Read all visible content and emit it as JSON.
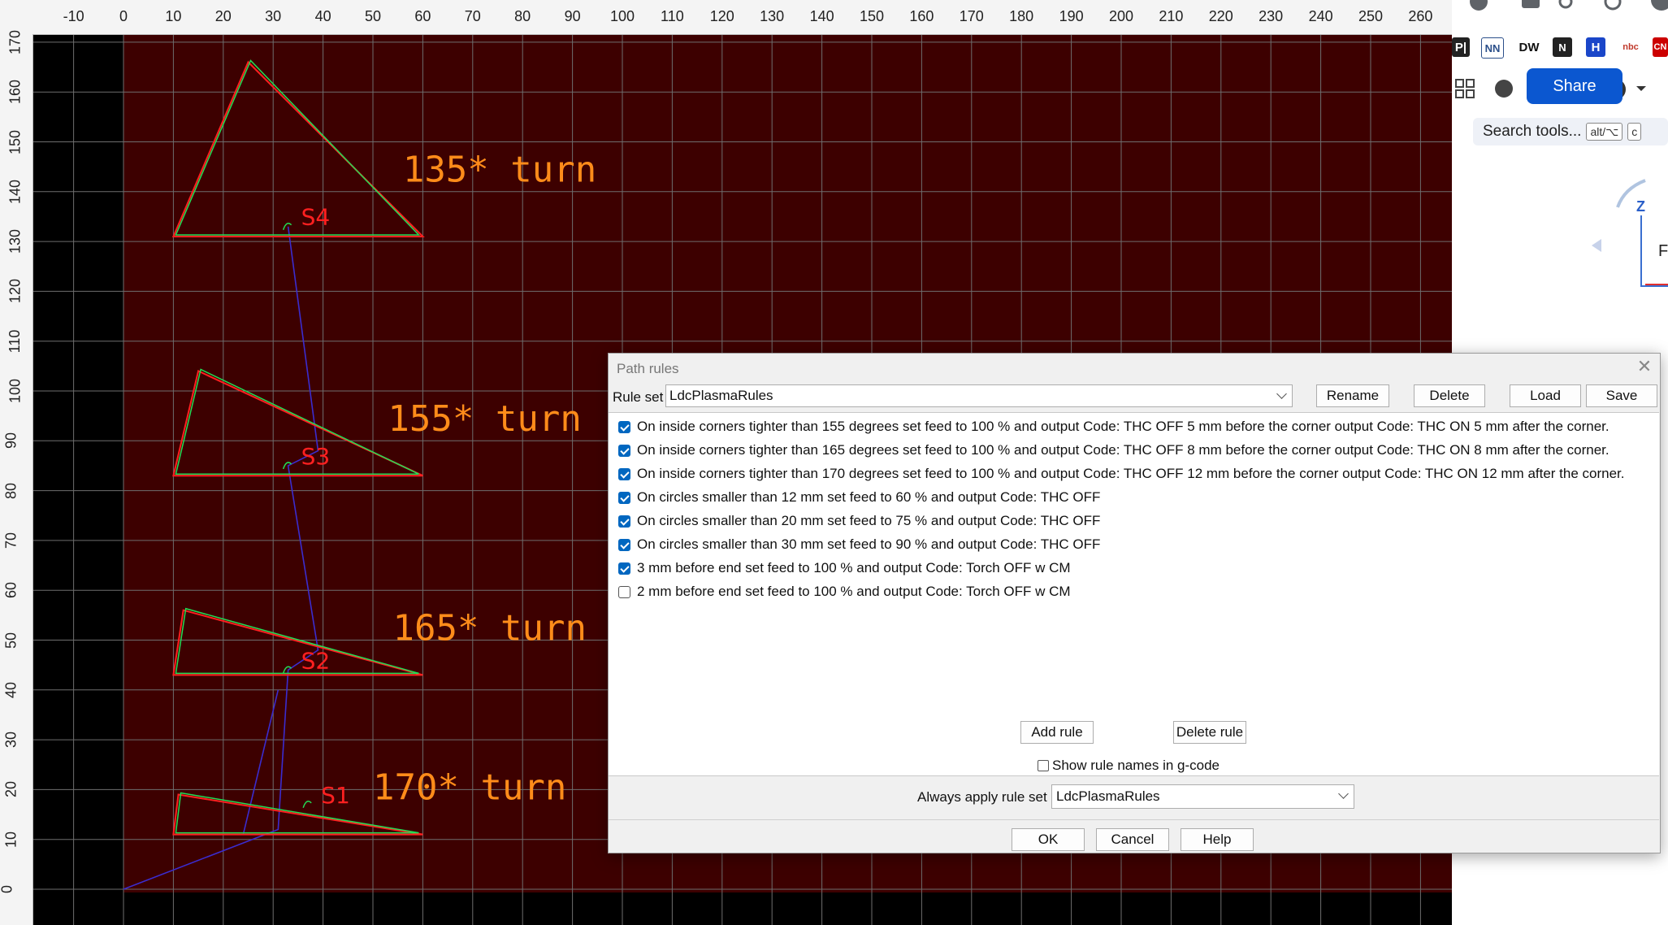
{
  "ruler": {
    "x_ticks": [
      "-10",
      "0",
      "10",
      "20",
      "30",
      "40",
      "50",
      "60",
      "70",
      "80",
      "90",
      "100",
      "110",
      "120",
      "130",
      "140",
      "150",
      "160",
      "170",
      "180",
      "190",
      "200",
      "210",
      "220",
      "230",
      "240",
      "250",
      "260"
    ],
    "y_ticks": [
      "170",
      "160",
      "150",
      "140",
      "130",
      "120",
      "110",
      "100",
      "90",
      "80",
      "70",
      "60",
      "50",
      "40",
      "30",
      "20",
      "10",
      "0"
    ]
  },
  "cad": {
    "background": "#3d0000",
    "grid_color": "#6e6e6e",
    "outline_color": "#ff2020",
    "path_color": "#22dd55",
    "rapid_color": "#3b2ccf",
    "label_color": "#ff8c1a",
    "turn_labels": [
      "135* turn",
      "155* turn",
      "165* turn",
      "170* turn"
    ],
    "start_labels": [
      "S4",
      "S3",
      "S2",
      "S1"
    ]
  },
  "browser": {
    "bookmarks": [
      "P|",
      "NN",
      "DW",
      "N",
      "H",
      "nbc",
      "CN"
    ],
    "share_label": "Share",
    "help_label": "?",
    "search_tools_label": "Search tools...",
    "search_tools_shortcut1": "alt/⌥",
    "search_tools_shortcut2": "c",
    "axis_label": "Z",
    "side_label": "Fi"
  },
  "dialog": {
    "title": "Path rules",
    "ruleset_label": "Rule set",
    "ruleset_value": "LdcPlasmaRules",
    "buttons": {
      "rename": "Rename",
      "delete": "Delete",
      "load": "Load",
      "save": "Save"
    },
    "rules": [
      {
        "checked": true,
        "text": "On inside corners tighter than 155 degrees set feed to 100 % and output Code: THC OFF 5 mm before the corner output Code: THC ON 5 mm after the corner."
      },
      {
        "checked": true,
        "text": "On inside corners tighter than 165 degrees set feed to 100 % and output Code: THC OFF 8 mm before the corner output Code: THC ON 8 mm after the corner."
      },
      {
        "checked": true,
        "text": "On inside corners tighter than 170 degrees set feed to 100 % and output Code: THC OFF 12 mm before the corner output Code: THC ON 12 mm after the corner."
      },
      {
        "checked": true,
        "text": "On circles smaller than 12 mm set feed to 60 % and output Code: THC OFF"
      },
      {
        "checked": true,
        "text": "On circles smaller than 20 mm set feed to 75 % and output Code: THC OFF"
      },
      {
        "checked": true,
        "text": "On circles smaller than 30 mm set feed to 90 % and output Code: THC OFF"
      },
      {
        "checked": true,
        "text": "3 mm before end set feed to 100 % and output Code: Torch OFF w CM"
      },
      {
        "checked": false,
        "text": "2 mm before end set feed to 100 % and output Code: Torch OFF w CM"
      }
    ],
    "add_rule": "Add rule",
    "delete_rule": "Delete rule",
    "show_names_label": "Show rule names in g-code",
    "show_names_checked": false,
    "always_label": "Always apply rule set",
    "always_value": "LdcPlasmaRules",
    "ok": "OK",
    "cancel": "Cancel",
    "help": "Help"
  }
}
